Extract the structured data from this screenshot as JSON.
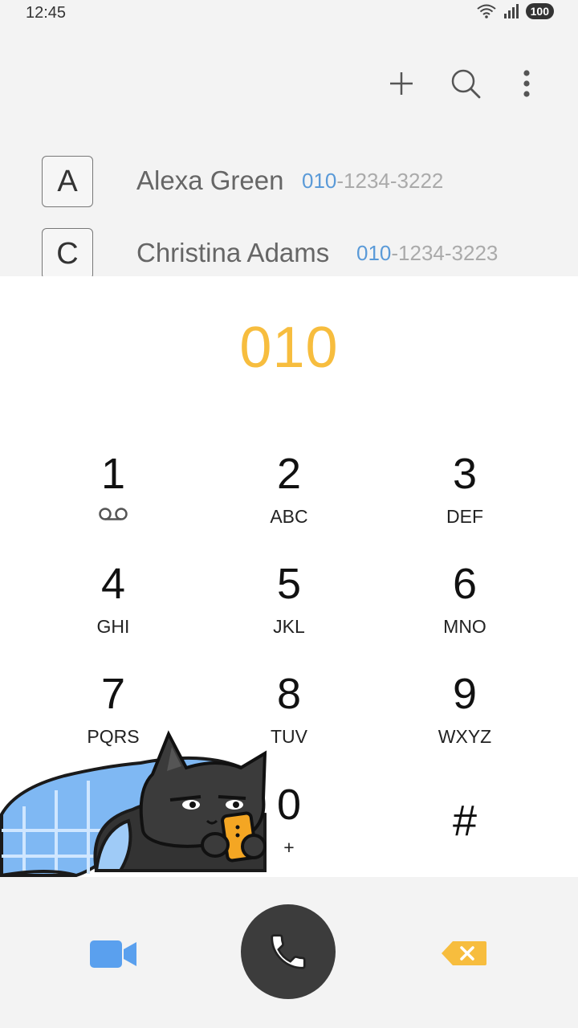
{
  "status_bar": {
    "time": "12:45",
    "battery": "100"
  },
  "toolbar": {
    "add_icon": "plus-icon",
    "search_icon": "search-icon",
    "more_icon": "more-vertical-icon"
  },
  "contacts": [
    {
      "initial": "A",
      "name": "Alexa Green",
      "number_prefix": "010",
      "number_rest": "-1234-3222"
    },
    {
      "initial": "C",
      "name": "Christina Adams",
      "number_prefix": "010",
      "number_rest": "-1234-3223"
    }
  ],
  "dialer": {
    "number": "010",
    "number_color": "#f7bd3e",
    "keys": [
      {
        "digit": "1",
        "letters": ""
      },
      {
        "digit": "2",
        "letters": "ABC"
      },
      {
        "digit": "3",
        "letters": "DEF"
      },
      {
        "digit": "4",
        "letters": "GHI"
      },
      {
        "digit": "5",
        "letters": "JKL"
      },
      {
        "digit": "6",
        "letters": "MNO"
      },
      {
        "digit": "7",
        "letters": "PQRS"
      },
      {
        "digit": "8",
        "letters": "TUV"
      },
      {
        "digit": "9",
        "letters": "WXYZ"
      },
      {
        "digit": "*",
        "letters": ""
      },
      {
        "digit": "0",
        "letters": "+"
      },
      {
        "digit": "#",
        "letters": ""
      }
    ]
  },
  "bottom_bar": {
    "video_icon": "video-call-icon",
    "call_icon": "phone-icon",
    "backspace_icon": "backspace-icon",
    "video_color": "#5aa0ee",
    "call_color": "#3c3c3c",
    "backspace_color": "#f7bd3e"
  }
}
